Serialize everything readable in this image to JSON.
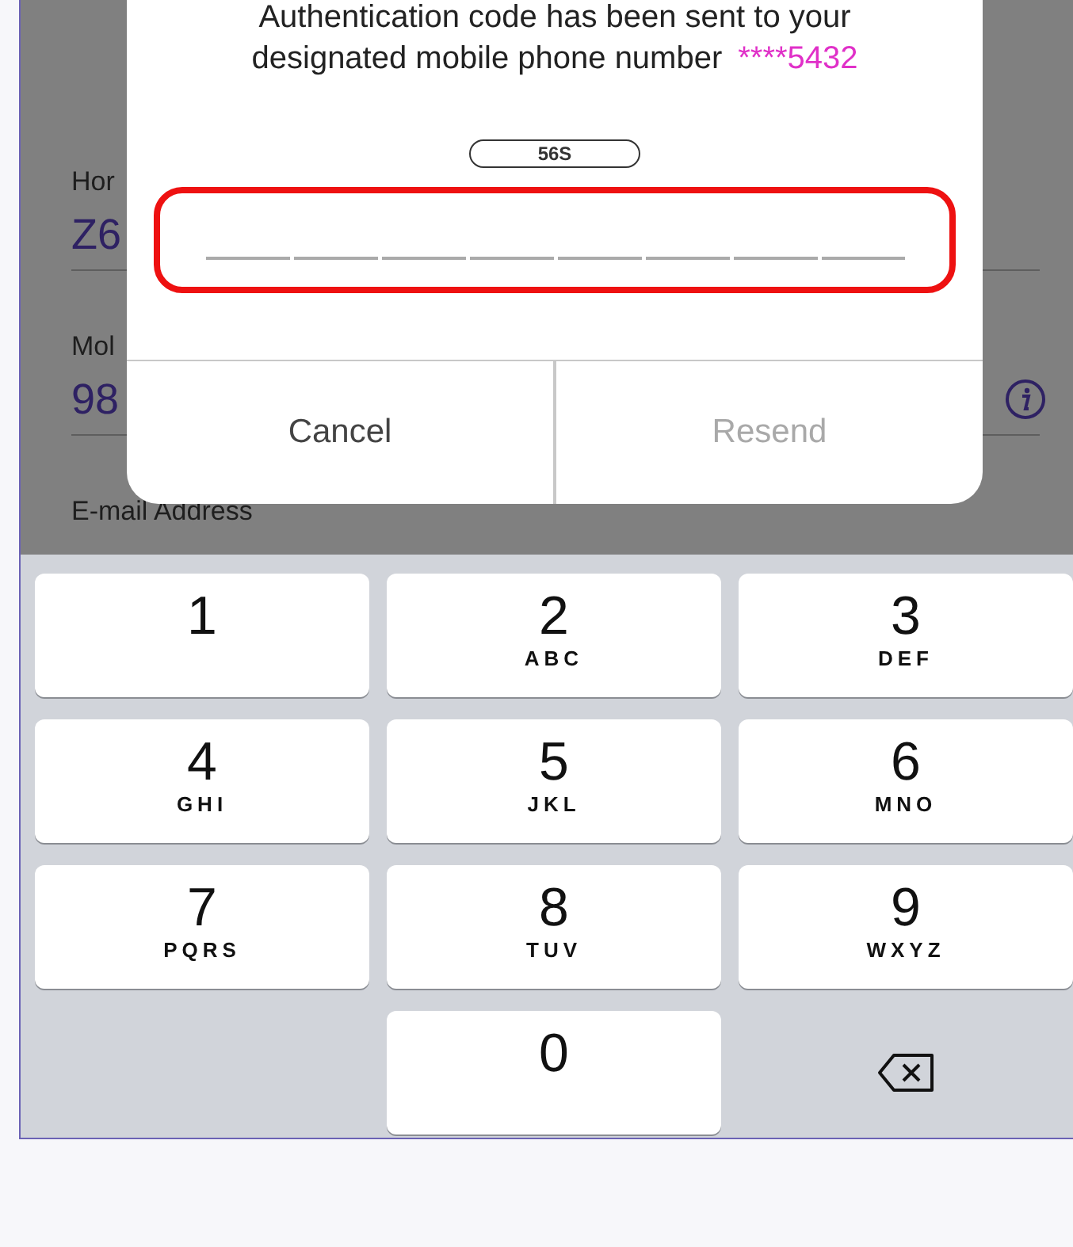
{
  "background_form": {
    "fields": [
      {
        "label": "Hor",
        "value": "Z6",
        "info": false
      },
      {
        "label": "Mol",
        "value": "98",
        "info": true
      },
      {
        "label": "E-mail Address"
      }
    ]
  },
  "dialog": {
    "message": "Authentication code has been sent to your designated mobile phone number",
    "masked_number": "****5432",
    "countdown": "56S",
    "code_field": {
      "highlighted": true
    },
    "buttons": [
      {
        "label": "Cancel",
        "disabled": false
      },
      {
        "label": "Resend",
        "disabled": true
      }
    ]
  },
  "keypad": {
    "keys": [
      {
        "kind": "digit",
        "digit": "1"
      },
      {
        "kind": "digit",
        "digit": "2",
        "letters": "ABC"
      },
      {
        "kind": "digit",
        "digit": "3",
        "letters": "DEF"
      },
      {
        "kind": "digit",
        "digit": "4",
        "letters": "GHI"
      },
      {
        "kind": "digit",
        "digit": "5",
        "letters": "JKL"
      },
      {
        "kind": "digit",
        "digit": "6",
        "letters": "MNO"
      },
      {
        "kind": "digit",
        "digit": "7",
        "letters": "PQRS"
      },
      {
        "kind": "digit",
        "digit": "8",
        "letters": "TUV"
      },
      {
        "kind": "digit",
        "digit": "9",
        "letters": "WXYZ"
      },
      {
        "kind": "digit",
        "digit": "0"
      },
      {
        "kind": "delete"
      }
    ]
  }
}
